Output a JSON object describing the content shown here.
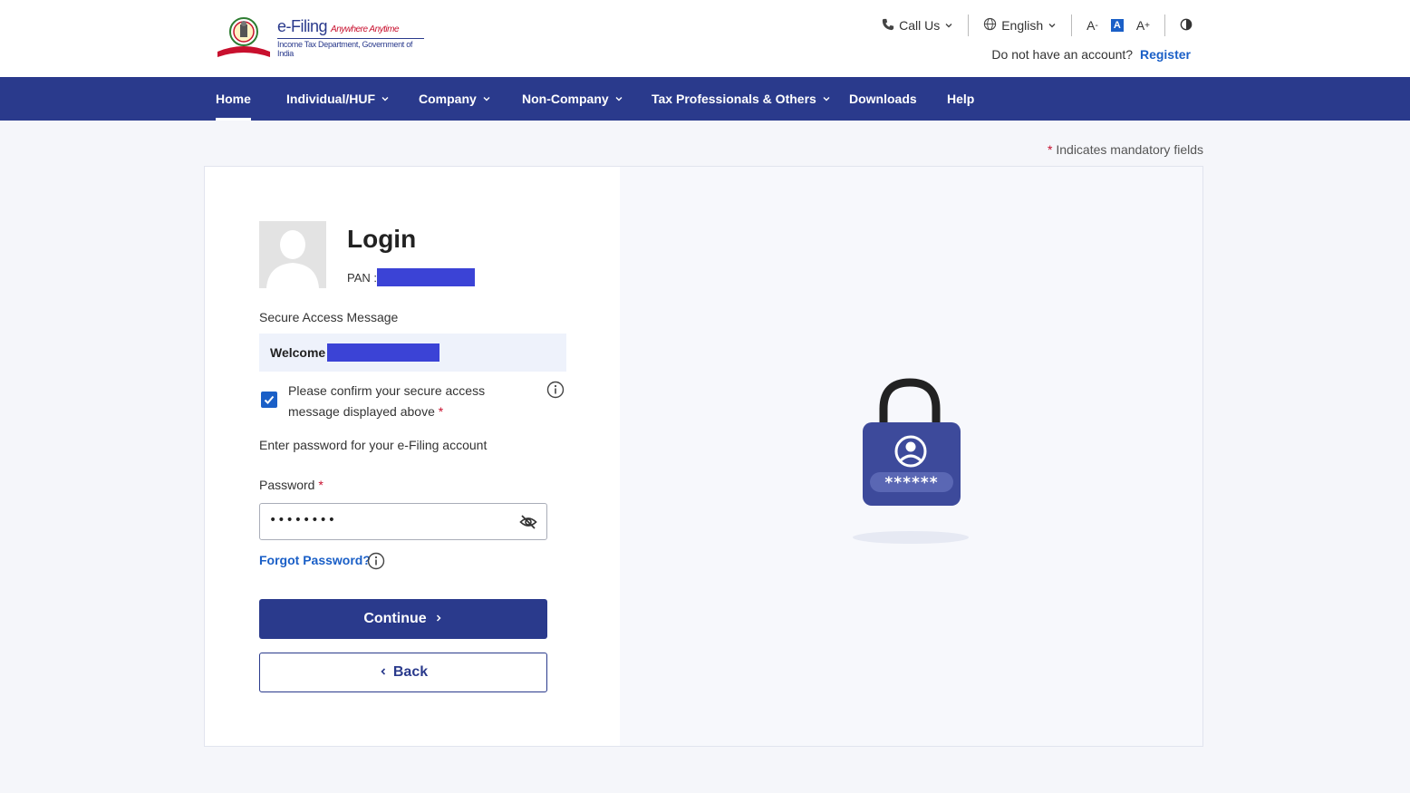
{
  "header": {
    "logo": {
      "main": "e-Filing",
      "tagline": "Anywhere Anytime",
      "sub": "Income Tax Department, Government of India"
    },
    "call_us": "Call Us",
    "language": "English",
    "font_decrease": "A",
    "font_normal": "A",
    "font_increase": "A",
    "account_prompt": "Do not have an account?",
    "register": "Register"
  },
  "nav": {
    "items": [
      {
        "label": "Home"
      },
      {
        "label": "Individual/HUF"
      },
      {
        "label": "Company"
      },
      {
        "label": "Non-Company"
      },
      {
        "label": "Tax Professionals & Others"
      },
      {
        "label": "Downloads"
      },
      {
        "label": "Help"
      }
    ]
  },
  "mandatory_note": "Indicates mandatory fields",
  "login": {
    "title": "Login",
    "pan_label": "PAN :",
    "secure_access_label": "Secure Access Message",
    "welcome_prefix": "Welcome",
    "confirm_text": "Please confirm your secure access message displayed above",
    "enter_password_text": "Enter password for your e-Filing account",
    "password_label": "Password",
    "password_value": "••••••••",
    "forgot_password": "Forgot Password?",
    "continue": "Continue",
    "back": "Back"
  },
  "illustration": {
    "mask_text": "******"
  },
  "colors": {
    "primary": "#2a3a8c",
    "link": "#1a5fc7",
    "required": "#c8102e",
    "redaction": "#3b43d6"
  }
}
